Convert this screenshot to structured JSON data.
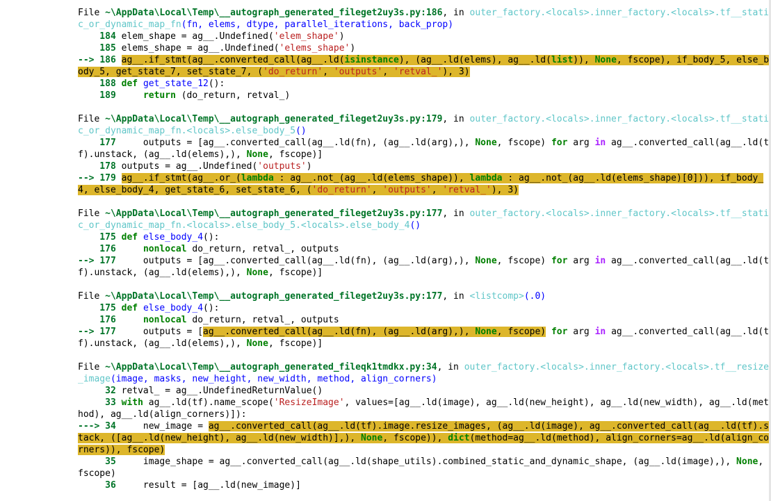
{
  "file_prefix": "File ",
  "in_word": ", in ",
  "arrow_3": "--> ",
  "arrow_4": "---> ",
  "frames": [
    {
      "path": "~\\AppData\\Local\\Temp\\__autograph_generated_fileget2uy3s.py:186",
      "func_1": "outer_factory.<locals>.inner_factory.<locals>.tf__stati",
      "func_2": "c_or_dynamic_map_fn",
      "args": "(fn, elems, dtype, parallel_iterations, back_prop)"
    },
    {
      "path": "~\\AppData\\Local\\Temp\\__autograph_generated_fileget2uy3s.py:179",
      "func_1": "outer_factory.<locals>.inner_factory.<locals>.tf__stati",
      "func_2": "c_or_dynamic_map_fn.<locals>.else_body_5",
      "args": "()"
    },
    {
      "path": "~\\AppData\\Local\\Temp\\__autograph_generated_fileget2uy3s.py:177",
      "func_1": "outer_factory.<locals>.inner_factory.<locals>.tf__stati",
      "func_2": "c_or_dynamic_map_fn.<locals>.else_body_5.<locals>.else_body_4",
      "args": "()"
    },
    {
      "path": "~\\AppData\\Local\\Temp\\__autograph_generated_fileget2uy3s.py:177",
      "func_1": "<listcomp>",
      "args": "(.0)"
    },
    {
      "path": "~\\AppData\\Local\\Temp\\__autograph_generated_fileqk1tmdkx.py:34",
      "func_1": "outer_factory.<locals>.inner_factory.<locals>.tf__resize",
      "func_2": "_image",
      "args": "(image, masks, new_height, new_width, method, align_corners)"
    }
  ]
}
